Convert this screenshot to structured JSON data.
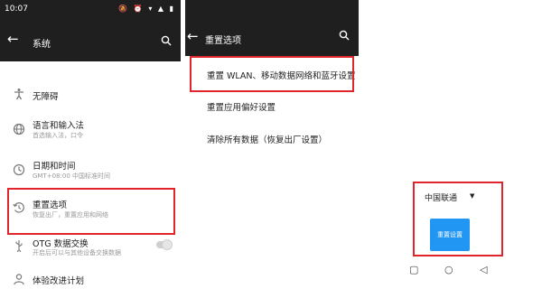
{
  "panel1": {
    "status_time": "10:07",
    "status_icons": "🔕 ⏰ ▾ ▲ ▮",
    "title": "系统",
    "back_icon": "←",
    "items": [
      {
        "title": "无障碍",
        "subtitle": "",
        "icon": "accessibility-icon"
      },
      {
        "title": "语言和输入法",
        "subtitle": "首选输入法，口令",
        "icon": "globe-icon"
      },
      {
        "title": "日期和时间",
        "subtitle": "GMT+08:00 中国标准时间",
        "icon": "clock-icon"
      },
      {
        "title": "重置选项",
        "subtitle": "恢复出厂，重置应用和网络",
        "icon": "history-icon"
      },
      {
        "title": "OTG 数据交换",
        "subtitle": "开启后可以与其他设备交换数据",
        "icon": "usb-icon"
      },
      {
        "title": "体验改进计划",
        "subtitle": "",
        "icon": "user-icon"
      }
    ]
  },
  "panel2": {
    "title": "重置选项",
    "back_icon": "←",
    "items": [
      "重置 WLAN、移动数据网络和蓝牙设置",
      "重置应用偏好设置",
      "清除所有数据（恢复出厂设置）"
    ]
  },
  "panel3": {
    "carrier": "中国联通",
    "caret": "▼",
    "reset_button": "重置设置",
    "nav": {
      "back": "◁",
      "home": "○",
      "recents": "▢"
    }
  },
  "colors": {
    "highlight": "#e0262a",
    "appbar": "#1f1f1f",
    "primary": "#2196f3"
  }
}
